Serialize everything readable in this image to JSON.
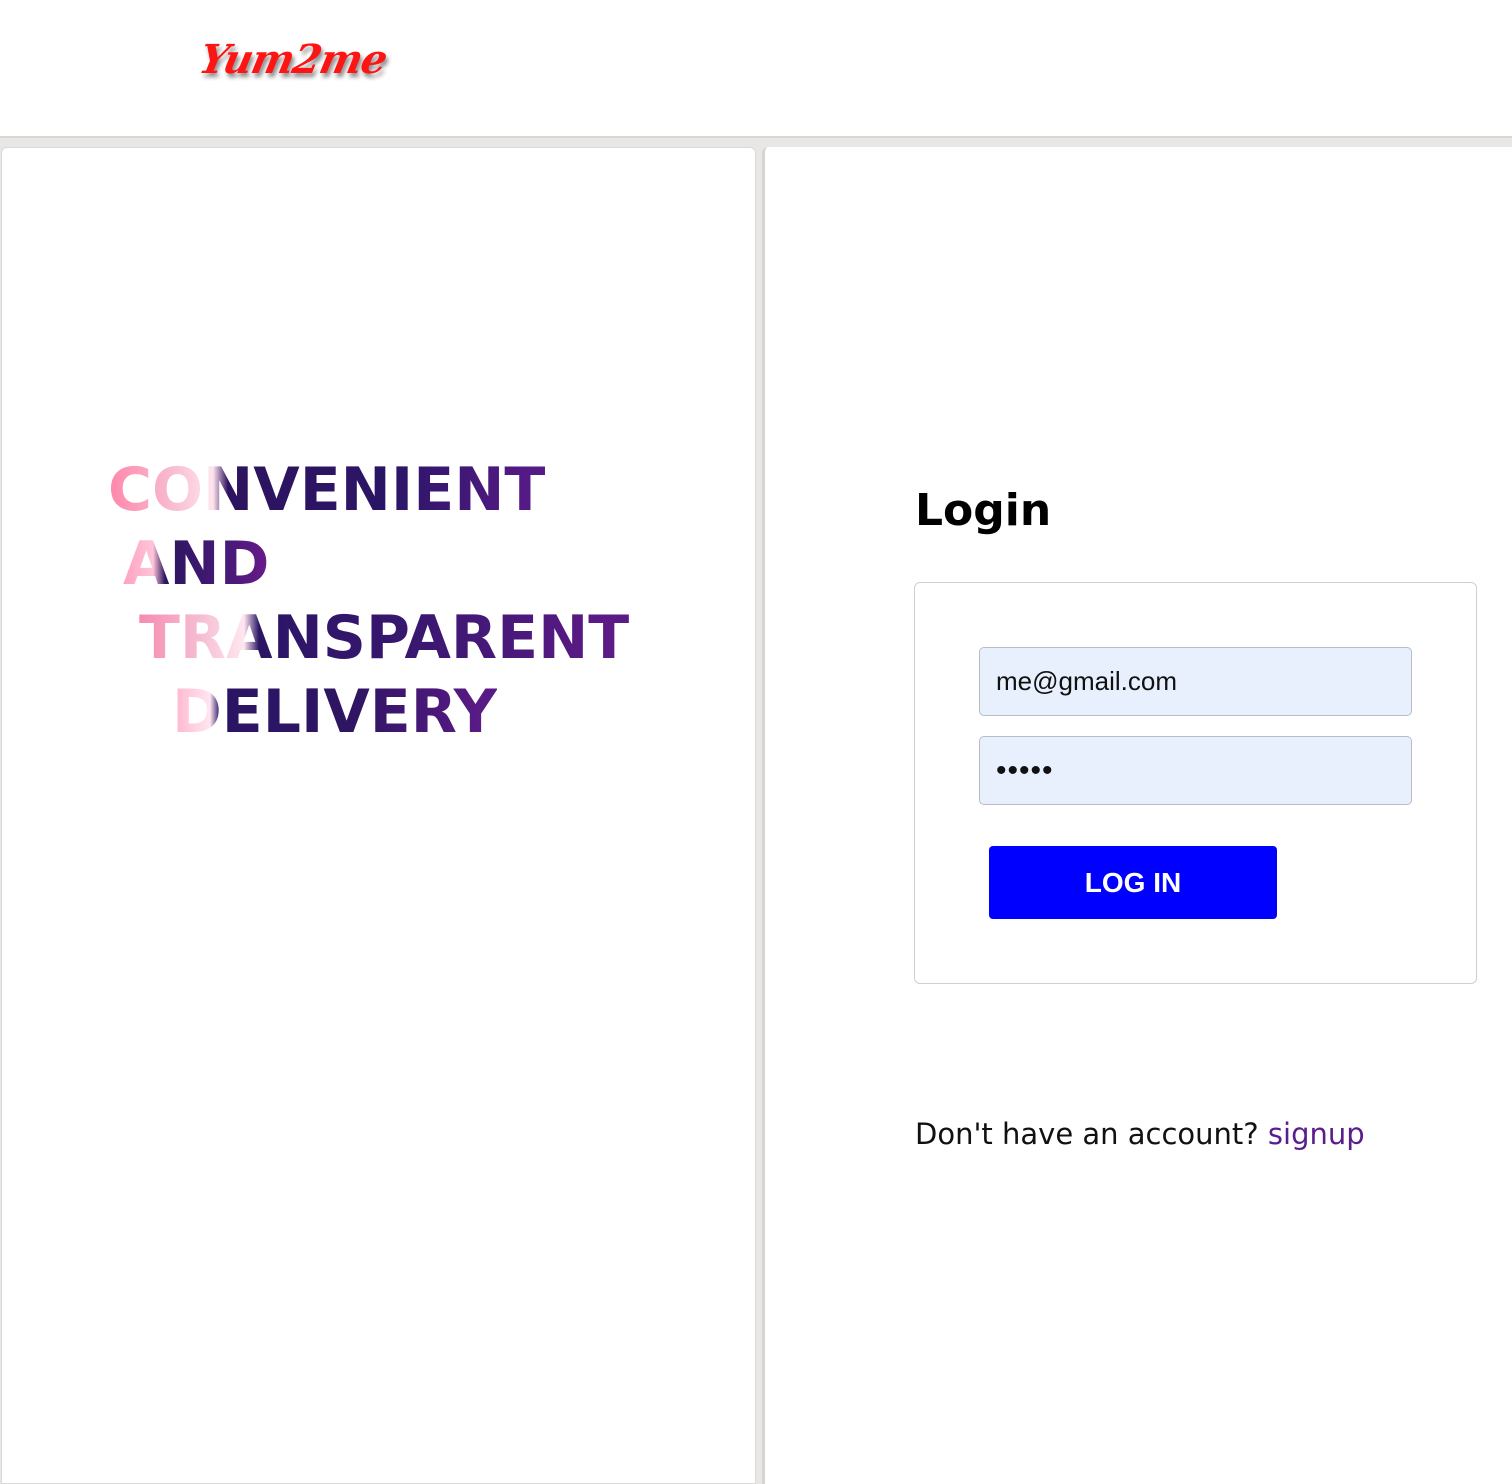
{
  "header": {
    "logo_text": "Yum2me"
  },
  "hero": {
    "lines": [
      "CONVENIENT",
      "AND",
      "TRANSPARENT",
      "DELIVERY"
    ]
  },
  "login": {
    "title": "Login",
    "email_value": "me@gmail.com",
    "password_value": "•••••",
    "button_label": "LOG IN",
    "signup_prompt": "Don't have an account? ",
    "signup_link": "signup"
  },
  "colors": {
    "logo": "#ff1414",
    "button": "#0000ff",
    "link": "#5a1d8c",
    "field_bg": "#e8f0fe"
  }
}
